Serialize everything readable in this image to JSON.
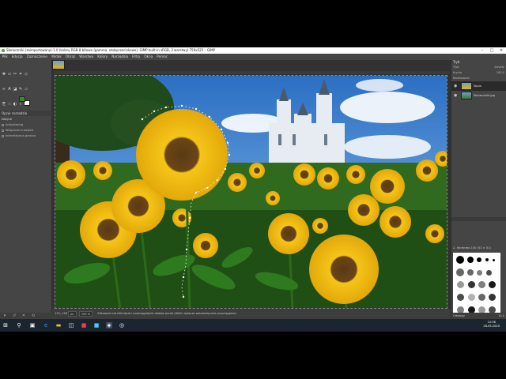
{
  "window": {
    "title": "Słoneczniki (zaimportowany)-1.0 (kolory RGB 8-bitowe (gamma, stałoprzecinkowe), GIMP built-in sRGB, 2 warstwy) 750x525 – GIMP",
    "minimize": "–",
    "maximize": "□",
    "close": "✕"
  },
  "menu": [
    "Plik",
    "Edycja",
    "Zaznaczenie",
    "Widok",
    "Obraz",
    "Warstwa",
    "Kolory",
    "Narzędzia",
    "Filtry",
    "Okna",
    "Pomoc"
  ],
  "toolbox": {
    "options_title": "Opcje narzędzia",
    "tool_name": "Nożyce",
    "options": [
      "Antyaliasing",
      "Wtapianie krawędzi",
      "Interaktywna granica"
    ]
  },
  "status": {
    "coords": "115, 139",
    "unit": "px",
    "zoom": "100 %",
    "message": "Kliknięcie lub kliknięcie i przeciągnięcie dodaje punkt (Shift: wyłącza automatyczne przyciąganie)"
  },
  "dock": {
    "tab_label": "Tryb",
    "mode_label": "Tryb",
    "mode_value": "Zwykły",
    "opacity_label": "Krycie",
    "opacity_value": "100,0",
    "lock_label": "Blokowanie:",
    "layers": [
      "Kopia",
      "Słoneczniki.jpg"
    ],
    "brush_title": "2. Hardness 100 (51 × 51)",
    "spacing_label": "Odstępy",
    "spacing_value": "10,0"
  },
  "taskbar": {
    "time": "10:56",
    "date": "28.05.2020"
  }
}
